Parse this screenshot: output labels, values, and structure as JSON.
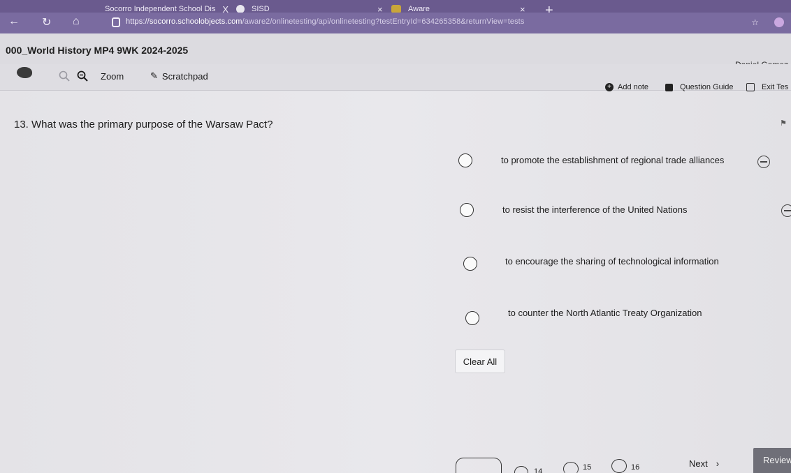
{
  "browser": {
    "tabs": [
      {
        "title": "Socorro Independent School Dis",
        "close": "X"
      },
      {
        "title": "SISD",
        "close": "×"
      },
      {
        "title": "Aware",
        "close": "×"
      }
    ],
    "new_tab": "+",
    "url": {
      "prefix": "https://",
      "host": "socorro.schoolobjects.com",
      "path": "/aware2/onlinetesting/api/onlinetesting?testEntryId=634265358&returnView=tests"
    }
  },
  "header": {
    "course_title": "000_World History MP4 9WK 2024-2025",
    "student_name": "Daniel Gomez"
  },
  "tools": {
    "zoom_label": "Zoom",
    "scratchpad_label": "Scratchpad",
    "add_note_label": "Add note",
    "question_guide_label": "Question Guide",
    "exit_label": "Exit Tes"
  },
  "question": {
    "number_and_text": "13. What was the primary purpose of the Warsaw Pact?",
    "choices": [
      "to promote the establishment of regional trade alliances",
      "to resist the interference of the United Nations",
      "to encourage the sharing of technological information",
      "to counter the North Atlantic Treaty Organization"
    ],
    "clear_all_label": "Clear All"
  },
  "navigation": {
    "numbers": [
      "14",
      "15",
      "16"
    ],
    "next_label": "Next",
    "next_chevron": "›",
    "review_label": "Review"
  }
}
